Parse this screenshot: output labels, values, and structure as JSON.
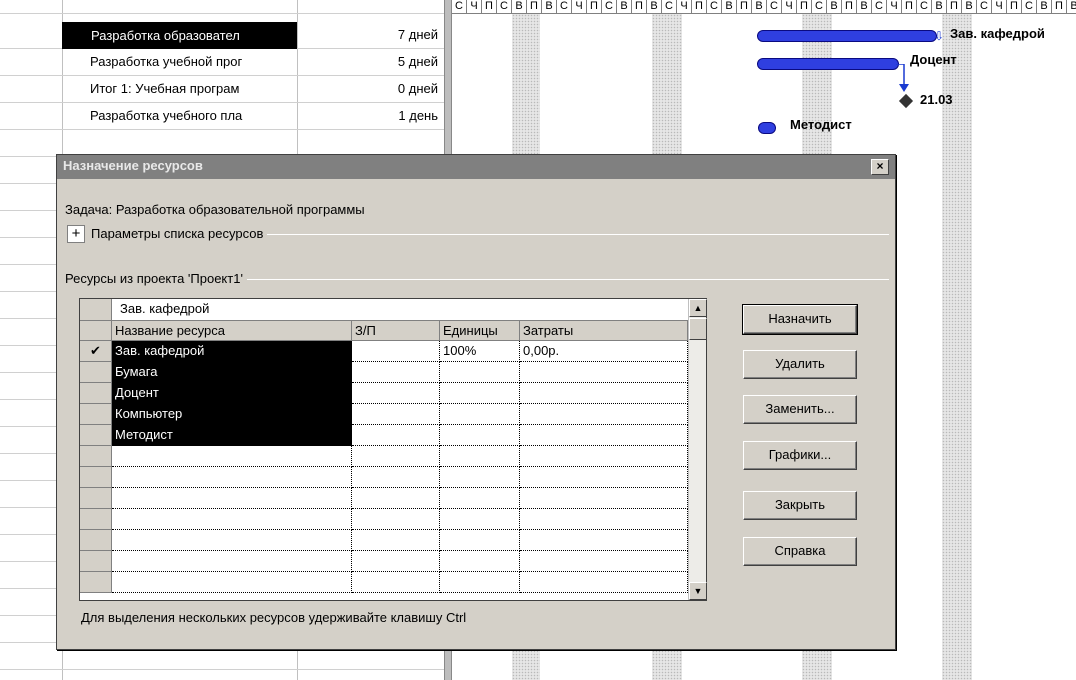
{
  "tasks": [
    {
      "name": "Разработка образовател",
      "duration": "7 дней",
      "selected": true
    },
    {
      "name": "Разработка учебной прог",
      "duration": "5 дней",
      "selected": false
    },
    {
      "name": "Итог 1: Учебная програм",
      "duration": "0 дней",
      "selected": false
    },
    {
      "name": "Разработка учебного пла",
      "duration": "1 день",
      "selected": false
    }
  ],
  "timescale": [
    "С",
    "Ч",
    "П",
    "С",
    "В",
    "П",
    "В",
    "С",
    "Ч",
    "П",
    "С",
    "В",
    "П",
    "В",
    "С",
    "Ч",
    "П",
    "С",
    "В",
    "П",
    "В",
    "С",
    "Ч",
    "П",
    "С",
    "В",
    "П",
    "В",
    "С",
    "Ч",
    "П",
    "С",
    "В",
    "П",
    "В",
    "С",
    "Ч",
    "П",
    "С",
    "В",
    "П",
    "В"
  ],
  "gantt_labels": {
    "bar1": "Зав. кафедрой",
    "bar2": "Доцент",
    "milestone": "21.03",
    "bar4": "Методист"
  },
  "dialog": {
    "title": "Назначение ресурсов",
    "close_label": "×",
    "task_line": "Задача: Разработка образовательной программы",
    "expand_label": "+",
    "resource_list_options": "Параметры списка ресурсов",
    "resources_group": "Ресурсы из проекта 'Проект1'",
    "edit_value": "Зав. кафедрой",
    "columns": [
      "Название ресурса",
      "З/П",
      "Единицы",
      "Затраты"
    ],
    "rows": [
      {
        "check": "✔",
        "name": "Зав. кафедрой",
        "rd": "",
        "units": "100%",
        "cost": "0,00р."
      },
      {
        "check": "",
        "name": "Бумага",
        "rd": "",
        "units": "",
        "cost": ""
      },
      {
        "check": "",
        "name": "Доцент",
        "rd": "",
        "units": "",
        "cost": ""
      },
      {
        "check": "",
        "name": "Компьютер",
        "rd": "",
        "units": "",
        "cost": ""
      },
      {
        "check": "",
        "name": "Методист",
        "rd": "",
        "units": "",
        "cost": ""
      }
    ],
    "empty_rows": 5,
    "buttons": {
      "assign": "Назначить",
      "remove": "Удалить",
      "replace": "Заменить...",
      "graphs": "Графики...",
      "close": "Закрыть",
      "help": "Справка"
    },
    "hint": "Для выделения нескольких ресурсов удерживайте клавишу Ctrl"
  }
}
